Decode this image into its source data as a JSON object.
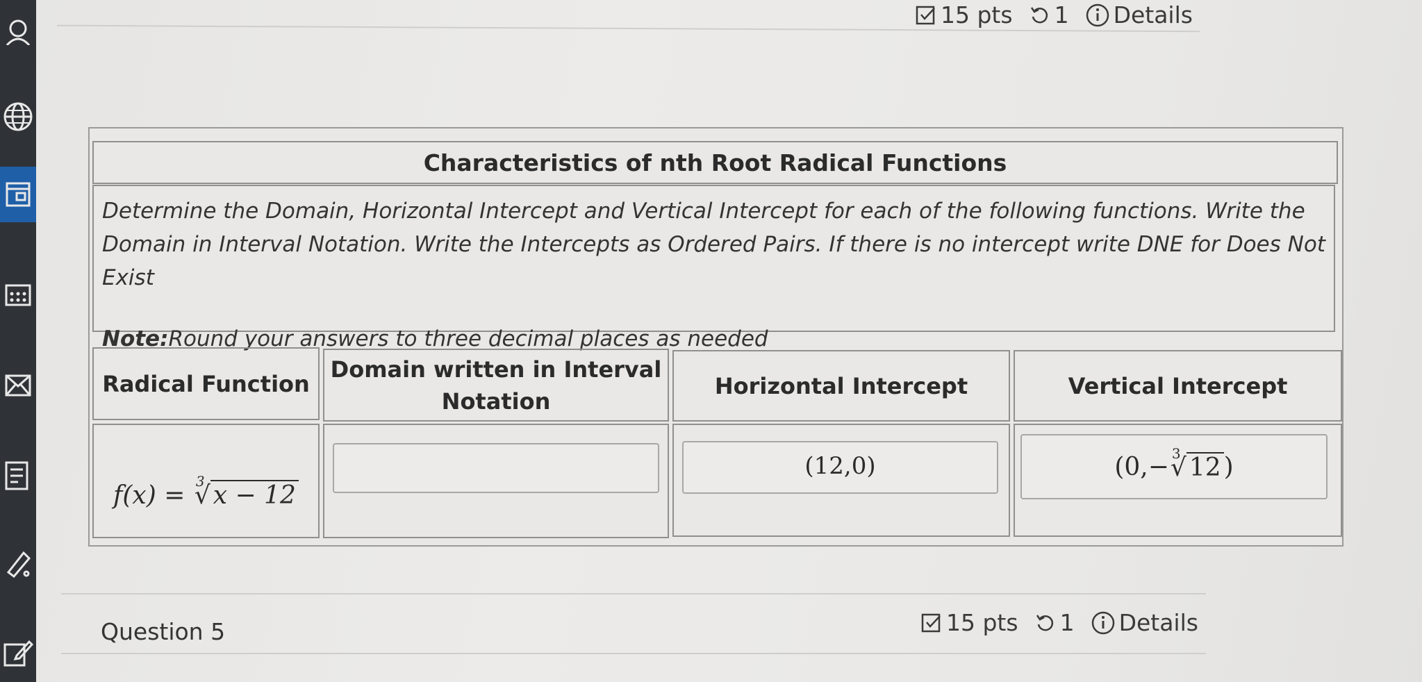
{
  "top_meta": {
    "points": "15 pts",
    "retries": "1",
    "details": "Details"
  },
  "table": {
    "title": "Characteristics of nth Root Radical Functions",
    "instructions_line1": "Determine the Domain, Horizontal Intercept and Vertical Intercept for each of the following functions. Write the",
    "instructions_line2": "Domain in Interval Notation. Write the Intercepts as Ordered Pairs. If there is no intercept write DNE for Does Not Exist",
    "note_label": "Note:",
    "note_text": "Round your answers to three decimal places as needed",
    "headers": {
      "function": "Radical Function",
      "domain_line1": "Domain written in Interval",
      "domain_line2": "Notation",
      "horizontal": "Horizontal Intercept",
      "vertical": "Vertical Intercept"
    },
    "row": {
      "function_lhs": "f(x) =",
      "function_index": "3",
      "function_radicand": "x − 12",
      "domain_value": "",
      "horizontal_value": "(12,0)",
      "vertical_prefix": "(0,−",
      "vertical_index": "3",
      "vertical_radicand": "12",
      "vertical_suffix": ")"
    }
  },
  "next_question": {
    "label": "Question 5",
    "points": "15 pts",
    "retries": "1",
    "details": "Details"
  }
}
